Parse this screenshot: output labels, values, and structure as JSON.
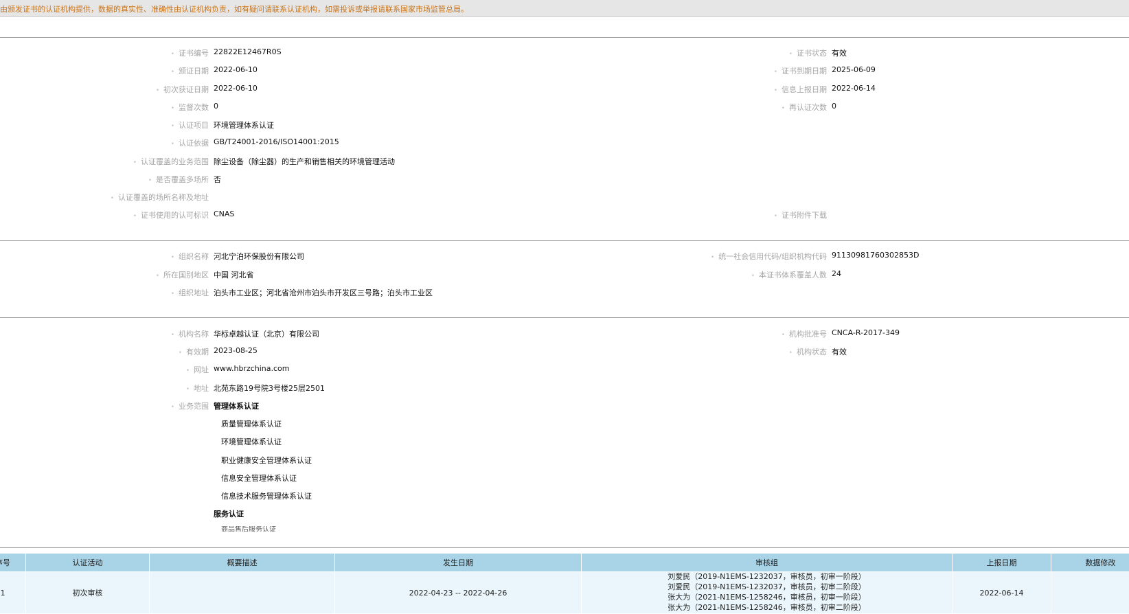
{
  "notice": "由颁发证书的认证机构提供，数据的真实性、准确性由认证机构负责，如有疑问请联系认证机构，如需投诉或举报请联系国家市场监管总局。",
  "certificate": {
    "left": [
      {
        "label": "证书编号",
        "value": "22822E12467R0S"
      },
      {
        "label": "颁证日期",
        "value": "2022-06-10"
      },
      {
        "label": "初次获证日期",
        "value": "2022-06-10"
      },
      {
        "label": "监督次数",
        "value": "0"
      },
      {
        "label": "认证项目",
        "value": "环境管理体系认证"
      },
      {
        "label": "认证依据",
        "value": "GB/T24001-2016/ISO14001:2015"
      },
      {
        "label": "认证覆盖的业务范围",
        "value": "除尘设备（除尘器）的生产和销售相关的环境管理活动"
      },
      {
        "label": "是否覆盖多场所",
        "value": "否"
      },
      {
        "label": "认证覆盖的场所名称及地址",
        "value": ""
      },
      {
        "label": "证书使用的认可标识",
        "value": "CNAS"
      }
    ],
    "right": [
      {
        "label": "证书状态",
        "value": "有效"
      },
      {
        "label": "证书到期日期",
        "value": "2025-06-09"
      },
      {
        "label": "信息上报日期",
        "value": "2022-06-14"
      },
      {
        "label": "再认证次数",
        "value": "0"
      },
      {
        "label": "证书附件下载",
        "value": ""
      }
    ]
  },
  "organization": {
    "left": [
      {
        "label": "组织名称",
        "value": "河北宁泊环保股份有限公司"
      },
      {
        "label": "所在国别地区",
        "value": "中国 河北省"
      },
      {
        "label": "组织地址",
        "value": "泊头市工业区；河北省沧州市泊头市开发区三号路；泊头市工业区"
      }
    ],
    "right": [
      {
        "label": "统一社会信用代码/组织机构代码",
        "value": "91130981760302853D"
      },
      {
        "label": "本证书体系覆盖人数",
        "value": "24"
      }
    ]
  },
  "agency": {
    "left": [
      {
        "label": "机构名称",
        "value": "华标卓越认证（北京）有限公司"
      },
      {
        "label": "有效期",
        "value": "2023-08-25"
      },
      {
        "label": "网址",
        "value": "www.hbrzchina.com"
      },
      {
        "label": "地址",
        "value": "北苑东路19号院3号楼25层2501"
      },
      {
        "label": "业务范围",
        "value": ""
      }
    ],
    "right": [
      {
        "label": "机构批准号",
        "value": "CNCA-R-2017-349"
      },
      {
        "label": "机构状态",
        "value": "有效"
      }
    ],
    "scope_heading_1": "管理体系认证",
    "scope_items": [
      "质量管理体系认证",
      "环境管理体系认证",
      "职业健康安全管理体系认证",
      "信息安全管理体系认证",
      "信息技术服务管理体系认证"
    ],
    "scope_heading_2": "服务认证",
    "scope_cut_item": "商品售后服务认证"
  },
  "audit_table": {
    "headers": [
      "序号",
      "认证活动",
      "概要描述",
      "发生日期",
      "审核组",
      "上报日期",
      "数据修改"
    ],
    "rows": [
      {
        "no": "1",
        "activity": "初次审核",
        "summary": "",
        "date": "2022-04-23 -- 2022-04-26",
        "team": [
          "刘爱民（2019-N1EMS-1232037，审核员，初审一阶段）",
          "刘爱民（2019-N1EMS-1232037，审核员，初审二阶段）",
          "张大为（2021-N1EMS-1258246，审核员，初审一阶段）",
          "张大为（2021-N1EMS-1258246，审核员，初审二阶段）"
        ],
        "report_date": "2022-06-14",
        "modify": ""
      }
    ]
  }
}
